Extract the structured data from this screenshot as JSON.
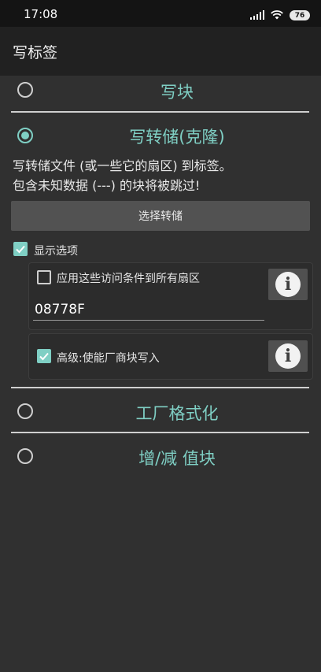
{
  "status_bar": {
    "time": "17:08",
    "battery": "76"
  },
  "toolbar": {
    "title": "写标签"
  },
  "options": {
    "write_block": {
      "label": "写块",
      "selected": false
    },
    "write_dump": {
      "label": "写转储(克隆)",
      "selected": true,
      "description_line1": "写转储文件 (或一些它的扇区) 到标签。",
      "description_line2": "包含未知数据 (---) 的块将被跳过!",
      "select_dump_button": "选择转储",
      "show_options": {
        "label": "显示选项",
        "checked": true
      },
      "access_conditions": {
        "label": "应用这些访问条件到所有扇区",
        "checked": false,
        "value": "08778F"
      },
      "advanced": {
        "label": "高级:使能厂商块写入",
        "checked": true
      }
    },
    "factory_format": {
      "label": "工厂格式化",
      "selected": false
    },
    "value_block": {
      "label": "增/减 值块",
      "selected": false
    }
  },
  "colors": {
    "accent": "#7fcfc4",
    "background": "#303030",
    "toolbar": "#212121"
  },
  "icons": [
    "signal-icon",
    "wifi-icon",
    "battery-icon",
    "info-icon",
    "checkmark-icon"
  ]
}
